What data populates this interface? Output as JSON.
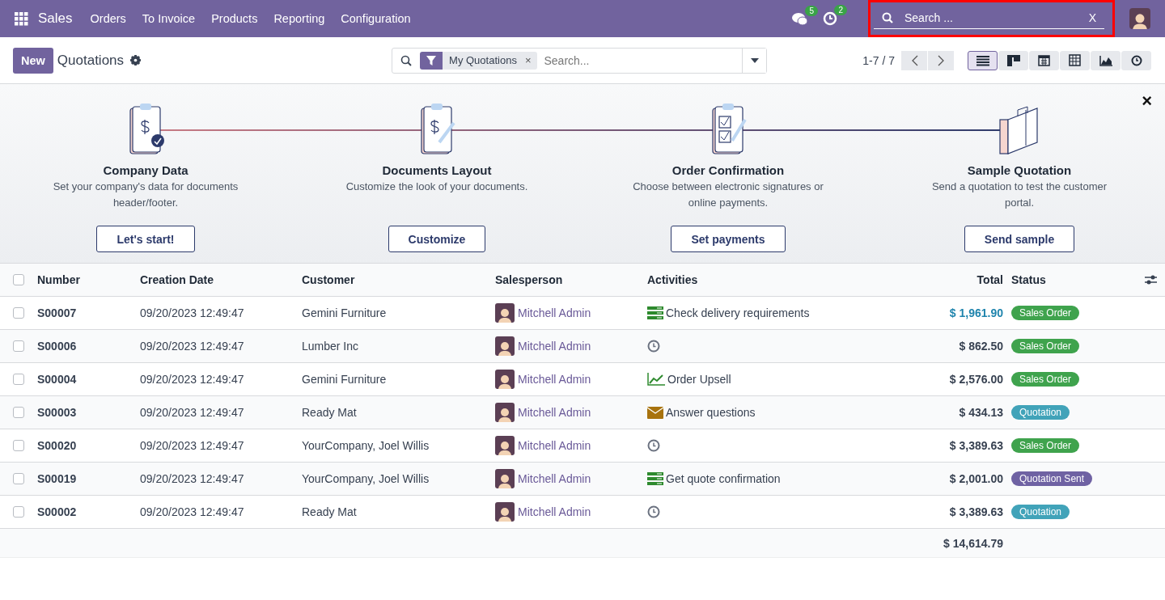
{
  "navbar": {
    "app": "Sales",
    "menu": [
      "Orders",
      "To Invoice",
      "Products",
      "Reporting",
      "Configuration"
    ],
    "messages_badge": "5",
    "activities_badge": "2",
    "search": {
      "placeholder": "Search ...",
      "clear": "X"
    }
  },
  "control_panel": {
    "new_button": "New",
    "title": "Quotations",
    "facet": "My Quotations",
    "facet_remove": "×",
    "search_placeholder": "Search...",
    "pager": "1-7 / 7",
    "views": [
      {
        "kind": "list",
        "selected": true
      },
      {
        "kind": "kanban",
        "selected": false
      },
      {
        "kind": "calendar",
        "selected": false
      },
      {
        "kind": "pivot",
        "selected": false
      },
      {
        "kind": "graph",
        "selected": false
      },
      {
        "kind": "activity",
        "selected": false
      }
    ]
  },
  "banner": {
    "close": "×",
    "steps": [
      {
        "kind": "company",
        "title": "Company Data",
        "description": "Set your company's data for documents header/footer.",
        "button": "Let's start!"
      },
      {
        "kind": "layout",
        "title": "Documents Layout",
        "description": "Customize the look of your documents.",
        "button": "Customize"
      },
      {
        "kind": "confirmation",
        "title": "Order Confirmation",
        "description": "Choose between electronic signatures or online payments.",
        "button": "Set payments"
      },
      {
        "kind": "sample",
        "title": "Sample Quotation",
        "description": "Send a quotation to test the customer portal.",
        "button": "Send sample"
      }
    ]
  },
  "table": {
    "select_all": {
      "checked": false
    },
    "columns": [
      "Number",
      "Creation Date",
      "Customer",
      "Salesperson",
      "Activities",
      "Total",
      "Status"
    ],
    "rows": [
      {
        "checked": false,
        "number": "S00007",
        "date": "09/20/2023 12:49:47",
        "customer": "Gemini Furniture",
        "salesperson": "Mitchell Admin",
        "activity": {
          "kind": "todo",
          "summary": "Check delivery requirements"
        },
        "total": "$ 1,961.90",
        "highlighted": true,
        "status": {
          "label": "Sales Order",
          "color": "#3fa34d"
        }
      },
      {
        "checked": false,
        "number": "S00006",
        "date": "09/20/2023 12:49:47",
        "customer": "Lumber Inc",
        "salesperson": "Mitchell Admin",
        "activity": {
          "kind": "clock"
        },
        "total": "$ 862.50",
        "highlighted": false,
        "status": {
          "label": "Sales Order",
          "color": "#3fa34d"
        }
      },
      {
        "checked": false,
        "number": "S00004",
        "date": "09/20/2023 12:49:47",
        "customer": "Gemini Furniture",
        "salesperson": "Mitchell Admin",
        "activity": {
          "kind": "upsell",
          "summary": "Order Upsell"
        },
        "total": "$ 2,576.00",
        "highlighted": false,
        "status": {
          "label": "Sales Order",
          "color": "#3fa34d"
        }
      },
      {
        "checked": false,
        "number": "S00003",
        "date": "09/20/2023 12:49:47",
        "customer": "Ready Mat",
        "salesperson": "Mitchell Admin",
        "activity": {
          "kind": "email",
          "summary": "Answer questions"
        },
        "total": "$ 434.13",
        "highlighted": false,
        "status": {
          "label": "Quotation",
          "color": "#41a3b9"
        }
      },
      {
        "checked": false,
        "number": "S00020",
        "date": "09/20/2023 12:49:47",
        "customer": "YourCompany, Joel Willis",
        "salesperson": "Mitchell Admin",
        "activity": {
          "kind": "clock"
        },
        "total": "$ 3,389.63",
        "highlighted": false,
        "status": {
          "label": "Sales Order",
          "color": "#3fa34d"
        }
      },
      {
        "checked": false,
        "number": "S00019",
        "date": "09/20/2023 12:49:47",
        "customer": "YourCompany, Joel Willis",
        "salesperson": "Mitchell Admin",
        "activity": {
          "kind": "todo",
          "summary": "Get quote confirmation"
        },
        "total": "$ 2,001.00",
        "highlighted": false,
        "status": {
          "label": "Quotation Sent",
          "color": "#6f62a3"
        }
      },
      {
        "checked": false,
        "number": "S00002",
        "date": "09/20/2023 12:49:47",
        "customer": "Ready Mat",
        "salesperson": "Mitchell Admin",
        "activity": {
          "kind": "clock"
        },
        "total": "$ 3,389.63",
        "highlighted": false,
        "status": {
          "label": "Quotation",
          "color": "#41a3b9"
        }
      }
    ],
    "footer_total": "$ 14,614.79"
  }
}
